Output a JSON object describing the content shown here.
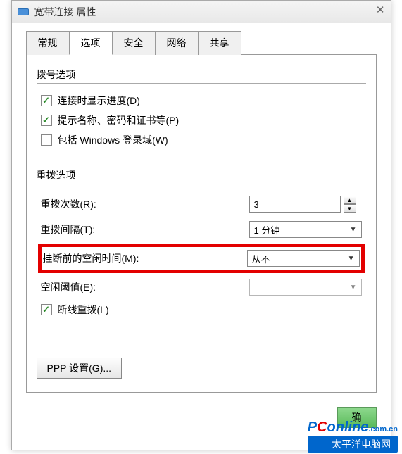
{
  "window": {
    "title": "宽带连接 属性"
  },
  "tabs": {
    "general": "常规",
    "options": "选项",
    "security": "安全",
    "network": "网络",
    "sharing": "共享"
  },
  "dialGroup": {
    "title": "拨号选项",
    "showProgress": "连接时显示进度(D)",
    "promptNamePwd": "提示名称、密码和证书等(P)",
    "includeWindowsDomain": "包括 Windows 登录域(W)"
  },
  "redialGroup": {
    "title": "重拨选项",
    "redialAttempts": {
      "label": "重拨次数(R):",
      "value": "3"
    },
    "redialInterval": {
      "label": "重拨间隔(T):",
      "value": "1 分钟"
    },
    "idleBeforeHangup": {
      "label": "挂断前的空闲时间(M):",
      "value": "从不"
    },
    "idleThreshold": {
      "label": "空闲阈值(E):",
      "value": ""
    },
    "redialOnDrop": "断线重拨(L)"
  },
  "pppButton": "PPP 设置(G)...",
  "okButton": "确",
  "watermark": {
    "brandP": "P",
    "brandC": "C",
    "brandRest": "online",
    "suffix": ".com.cn",
    "cn": "太平洋电脑网"
  }
}
